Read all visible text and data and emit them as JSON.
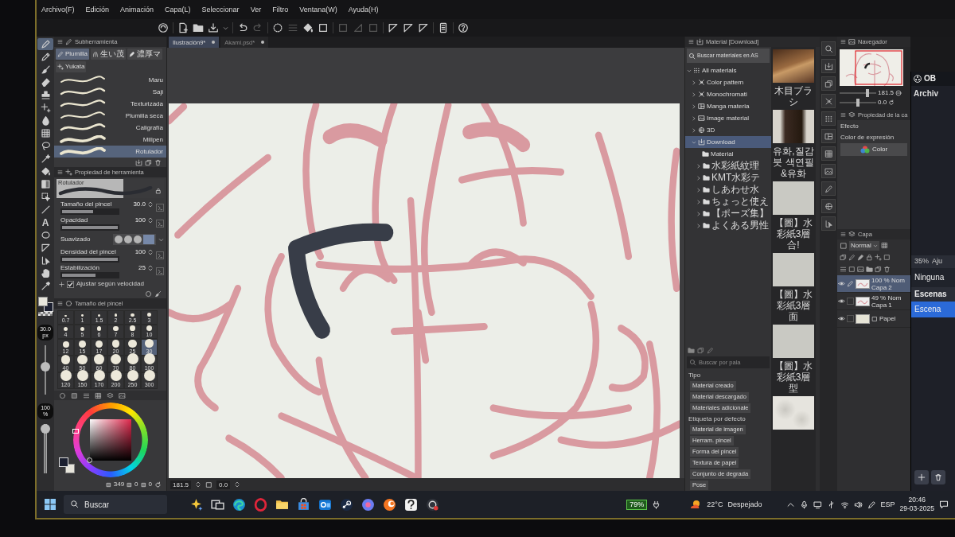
{
  "menu": [
    "Archivo(F)",
    "Edición",
    "Animación",
    "Capa(L)",
    "Seleccionar",
    "Ver",
    "Filtro",
    "Ventana(W)",
    "Ayuda(H)"
  ],
  "toolbar": [
    {
      "kind": "logo",
      "disabled": false
    },
    {
      "kind": "new-file",
      "disabled": false
    },
    {
      "kind": "folder",
      "disabled": false
    },
    {
      "kind": "save",
      "disabled": false
    },
    {
      "kind": "caret",
      "disabled": false
    },
    {
      "kind": "undo",
      "disabled": false
    },
    {
      "kind": "redo",
      "disabled": true
    },
    {
      "kind": "dotted-circle",
      "disabled": false
    },
    {
      "kind": "lines",
      "disabled": true
    },
    {
      "kind": "bucket",
      "disabled": false
    },
    {
      "kind": "frame",
      "disabled": false
    },
    {
      "kind": "frame",
      "disabled": true
    },
    {
      "kind": "triangle",
      "disabled": true
    },
    {
      "kind": "frame",
      "disabled": true
    },
    {
      "kind": "ruler",
      "disabled": false
    },
    {
      "kind": "ruler",
      "disabled": false
    },
    {
      "kind": "ruler",
      "disabled": false
    },
    {
      "kind": "tablet",
      "disabled": false
    },
    {
      "kind": "help",
      "disabled": false
    }
  ],
  "documents": [
    {
      "title": "Ilustración9*",
      "selected": true
    },
    {
      "title": "Akami.psd*",
      "selected": false
    }
  ],
  "tools": [
    {
      "kind": "pen",
      "selected": true
    },
    {
      "kind": "pencil",
      "selected": false
    },
    {
      "kind": "brush",
      "selected": false
    },
    {
      "kind": "eraser",
      "selected": false
    },
    {
      "kind": "stamp",
      "selected": false
    },
    {
      "kind": "sparkle",
      "selected": false
    },
    {
      "kind": "blend",
      "selected": false
    },
    {
      "kind": "grid",
      "selected": false
    },
    {
      "kind": "lasso",
      "selected": false
    },
    {
      "kind": "wand",
      "selected": false
    },
    {
      "kind": "bucket",
      "selected": false
    },
    {
      "kind": "gradient",
      "selected": false
    },
    {
      "kind": "object",
      "selected": false
    },
    {
      "kind": "line",
      "selected": false
    },
    {
      "kind": "text",
      "label": "A",
      "selected": false
    },
    {
      "kind": "ellipse",
      "selected": false
    },
    {
      "kind": "ruler",
      "selected": false
    },
    {
      "kind": "pointer",
      "selected": false
    },
    {
      "kind": "hand",
      "selected": false
    },
    {
      "kind": "eyedropper",
      "selected": false
    }
  ],
  "brush_size_indicator": {
    "value": "30.0",
    "unit": "px",
    "level": 0.58
  },
  "opacity_indicator": {
    "value": "100",
    "unit": "%",
    "level": 1
  },
  "subtool_panel": {
    "title": "Subherramienta",
    "groups": [
      {
        "label": "Plumilla",
        "selected": true
      },
      {
        "label": "生い茂",
        "selected": false
      },
      {
        "label": "濃厚マ",
        "selected": false
      },
      {
        "label": "Yukata",
        "selected": false
      }
    ],
    "brushes": [
      {
        "name": "Maru",
        "selected": false
      },
      {
        "name": "Saji",
        "selected": false
      },
      {
        "name": "Texturizada",
        "selected": false
      },
      {
        "name": "Plumilla seca",
        "selected": false
      },
      {
        "name": "Caligrafía",
        "selected": false
      },
      {
        "name": "Millpen",
        "selected": false
      },
      {
        "name": "Rotulador",
        "selected": true
      }
    ]
  },
  "tool_property": {
    "title": "Propiedad de herramienta",
    "preview_label": "Rotulador",
    "rows": [
      {
        "kind": "slider",
        "label": "Tamaño del pincel",
        "value": "30.0",
        "level": 0.55
      },
      {
        "kind": "slider",
        "label": "Opacidad",
        "value": "100",
        "level": 1
      },
      {
        "kind": "steps",
        "label": "Suavizado",
        "steps": [
          {
            "selected": false
          },
          {
            "selected": false
          },
          {
            "selected": false
          },
          {
            "selected": true
          }
        ]
      },
      {
        "kind": "slider",
        "label": "Densidad del pincel",
        "value": "100",
        "level": 1
      },
      {
        "kind": "slider",
        "label": "Estabilización",
        "value": "25",
        "level": 0.6
      },
      {
        "kind": "check",
        "label": "Ajustar según velocidad",
        "checked": true
      }
    ]
  },
  "brush_size_panel": {
    "title": "Tamaño del pincel",
    "sizes": [
      {
        "label": "0.7",
        "selected": false
      },
      {
        "label": "1",
        "selected": false
      },
      {
        "label": "1.5",
        "selected": false
      },
      {
        "label": "2",
        "selected": false
      },
      {
        "label": "2.5",
        "selected": false
      },
      {
        "label": "3",
        "selected": false
      },
      {
        "label": "4",
        "selected": false
      },
      {
        "label": "5",
        "selected": false
      },
      {
        "label": "6",
        "selected": false
      },
      {
        "label": "7",
        "selected": false
      },
      {
        "label": "8",
        "selected": false
      },
      {
        "label": "10",
        "selected": false
      },
      {
        "label": "12",
        "selected": false
      },
      {
        "label": "15",
        "selected": false
      },
      {
        "label": "17",
        "selected": false
      },
      {
        "label": "20",
        "selected": false
      },
      {
        "label": "25",
        "selected": false
      },
      {
        "label": "30",
        "selected": true
      },
      {
        "label": "40",
        "selected": false
      },
      {
        "label": "50",
        "selected": false
      },
      {
        "label": "60",
        "selected": false
      },
      {
        "label": "70",
        "selected": false
      },
      {
        "label": "80",
        "selected": false
      },
      {
        "label": "100",
        "selected": false
      },
      {
        "label": "120",
        "selected": false
      },
      {
        "label": "150",
        "selected": false
      },
      {
        "label": "170",
        "selected": false
      },
      {
        "label": "200",
        "selected": false
      },
      {
        "label": "250",
        "selected": false
      },
      {
        "label": "300",
        "selected": false
      }
    ]
  },
  "color_panel": {
    "readout": [
      "349",
      "0",
      "0"
    ]
  },
  "canvas": {
    "zoom": "181.5",
    "angle": "0.0"
  },
  "material_panel": {
    "title": "Material [Download]",
    "search_button": "Buscar materiales en AS",
    "tree": [
      {
        "label": "All materials",
        "kind": "grid",
        "expanded": true,
        "selected": false,
        "children": [
          {
            "label": "Color pattern",
            "kind": "pattern",
            "expanded": false,
            "selected": false
          },
          {
            "label": "Monochromati",
            "kind": "pattern",
            "expanded": false,
            "selected": false
          },
          {
            "label": "Manga materia",
            "kind": "panel",
            "expanded": false,
            "selected": false
          },
          {
            "label": "Image material",
            "kind": "image",
            "expanded": false,
            "selected": false
          },
          {
            "label": "3D",
            "kind": "sphere",
            "expanded": false,
            "selected": false
          },
          {
            "label": "Download",
            "kind": "download",
            "expanded": true,
            "selected": true,
            "children": [
              {
                "label": "Material",
                "kind": "leaf",
                "selected": false
              },
              {
                "label": "水彩紙紋理",
                "kind": "folder",
                "expanded": false,
                "selected": false
              },
              {
                "label": "KMT水彩テ",
                "kind": "folder",
                "expanded": false,
                "selected": false
              },
              {
                "label": "しあわせ水",
                "kind": "folder",
                "expanded": false,
                "selected": false
              },
              {
                "label": "ちょっと使え",
                "kind": "folder",
                "expanded": false,
                "selected": false
              },
              {
                "label": "【ポーズ集】",
                "kind": "folder",
                "expanded": false,
                "selected": false
              },
              {
                "label": "よくある男性",
                "kind": "folder",
                "expanded": false,
                "selected": false
              }
            ]
          }
        ]
      }
    ],
    "thumbnails": [
      {
        "kind": "wood",
        "caption": "木目ブラシ"
      },
      {
        "kind": "dark",
        "caption": "유화,질감붓 색연필&유화"
      },
      {
        "kind": "paper",
        "caption": "【圖】水彩紙3層合!"
      },
      {
        "kind": "paper",
        "caption": "【圖】水彩紙3層面"
      },
      {
        "kind": "paper",
        "caption": "【圖】水彩紙3層型"
      },
      {
        "kind": "marble"
      }
    ],
    "tag_search_placeholder": "Buscar por pala",
    "tag_groups": [
      {
        "heading": "Tipo",
        "tags": [
          "Material creado",
          "Material descargado",
          "Materiales adicionale"
        ]
      },
      {
        "heading": "Etiqueta por defecto",
        "tags": [
          "Material de imagen",
          "Herram. pincel",
          "Forma del pincel",
          "Textura de papel",
          "Conjunto de degrada",
          "Pose"
        ]
      }
    ]
  },
  "navigator": {
    "title": "Navegador",
    "zoom": "181.5",
    "zoom_slider": {
      "level": 0.78
    },
    "angle": "0.0",
    "angle_slider": {
      "level": 0.5
    }
  },
  "layer_property": {
    "title": "Propiedad de la ca",
    "effect_label": "Efecto",
    "expression_label": "Color de expresión",
    "expression_button": "Color"
  },
  "layer_panel": {
    "title": "Capa",
    "blend_mode": "Normal",
    "layers": [
      {
        "kind": "raster",
        "mode": "100 % Nom",
        "name": "Capa 2",
        "visible": true,
        "target": true,
        "selected": true
      },
      {
        "kind": "raster",
        "mode": "49 % Nom",
        "name": "Capa 1",
        "visible": true,
        "target": false,
        "selected": false
      },
      {
        "kind": "paper",
        "name": "Papel",
        "visible": true,
        "target": false,
        "selected": false
      }
    ]
  },
  "obs_window": {
    "title": "OB",
    "menu": "Archiv",
    "volume": "35%",
    "volume_label": "Aju",
    "transition": "Ninguna",
    "scenes_title": "Escenas",
    "scenes": [
      {
        "name": "Escena",
        "selected": true
      }
    ]
  },
  "taskbar": {
    "search_placeholder": "Buscar",
    "battery": "79%",
    "temperature": "22°C",
    "weather": "Despejado",
    "language": "ESP",
    "time": "20:46",
    "date": "29-03-2025"
  }
}
